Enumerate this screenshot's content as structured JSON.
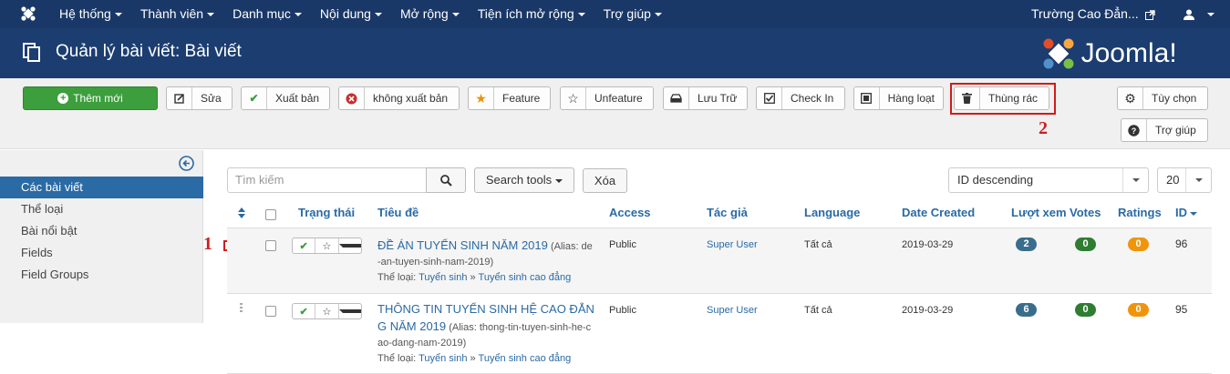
{
  "colors": {
    "navbar": "#1a3867",
    "header": "#1c3d70",
    "accent": "#2a6aa5",
    "green": "#3c9e3c",
    "annotation": "#cc1f1f"
  },
  "topnav": {
    "logo_icon": "joomla-icon",
    "menu": [
      "Hệ thống",
      "Thành viên",
      "Danh mục",
      "Nội dung",
      "Mở rộng",
      "Tiện ích mở rộng",
      "Trợ giúp"
    ],
    "site_name": "Trường Cao Đẳn...",
    "user_icon": "user-icon"
  },
  "header": {
    "title": "Quản lý bài viết: Bài viết",
    "brand": "Joomla!"
  },
  "toolbar": {
    "new": "Thêm mới",
    "edit": "Sửa",
    "publish": "Xuất bản",
    "unpublish": "không xuất bản",
    "feature": "Feature",
    "unfeature": "Unfeature",
    "archive": "Lưu Trữ",
    "checkin": "Check In",
    "batch": "Hàng loạt",
    "trash": "Thùng rác",
    "options": "Tùy chọn",
    "help": "Trợ giúp"
  },
  "annotations": {
    "step1": "1",
    "step2": "2"
  },
  "sidebar": {
    "items": [
      "Các bài viết",
      "Thể loại",
      "Bài nổi bật",
      "Fields",
      "Field Groups"
    ],
    "active_index": 0
  },
  "filters": {
    "search_placeholder": "Tìm kiếm",
    "search_tools": "Search tools",
    "clear": "Xóa",
    "ordering": "ID descending",
    "limit": "20"
  },
  "table": {
    "headers": {
      "status": "Trạng thái",
      "title": "Tiêu đề",
      "access": "Access",
      "author": "Tác giả",
      "language": "Language",
      "date": "Date Created",
      "hits": "Lượt xem",
      "votes": "Votes",
      "ratings": "Ratings",
      "id": "ID"
    },
    "rows": [
      {
        "title_line1": "ĐỀ ÁN TUYỂN SINH NĂM 2019",
        "title_line2": "",
        "alias_a": "(Alias: de",
        "alias_b": "-an-tuyen-sinh-nam-2019)",
        "cat_label": "Thể loại:",
        "cat_parent": "Tuyển sinh",
        "cat_sep": "»",
        "cat_child": "Tuyển sinh cao đẳng",
        "access": "Public",
        "author": "Super User",
        "language": "Tất cả",
        "date": "2019-03-29",
        "hits": "2",
        "votes": "0",
        "ratings": "0",
        "id": "96"
      },
      {
        "title_line1": "THÔNG TIN TUYỂN SINH HỆ CAO ĐẲN",
        "title_line2": "G NĂM 2019",
        "alias_a": "(Alias: thong-tin-tuyen-sinh-he-c",
        "alias_b": "ao-dang-nam-2019)",
        "cat_label": "Thể loại:",
        "cat_parent": "Tuyển sinh",
        "cat_sep": "»",
        "cat_child": "Tuyển sinh cao đẳng",
        "access": "Public",
        "author": "Super User",
        "language": "Tất cả",
        "date": "2019-03-29",
        "hits": "6",
        "votes": "0",
        "ratings": "0",
        "id": "95"
      }
    ]
  }
}
